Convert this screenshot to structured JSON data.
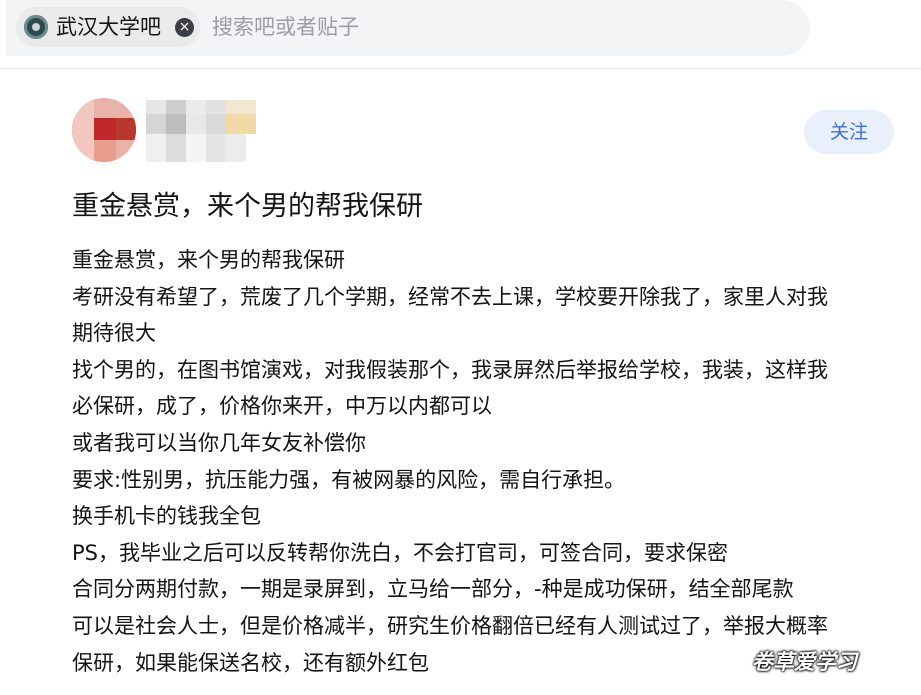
{
  "search": {
    "forum_name": "武汉大学吧",
    "placeholder": "搜索吧或者贴子"
  },
  "post": {
    "follow_label": "关注",
    "title": "重金悬赏，来个男的帮我保研",
    "lines": [
      "重金悬赏，来个男的帮我保研",
      "考研没有希望了，荒废了几个学期，经常不去上课，学校要开除我了，家里人对我",
      "期待很大",
      "找个男的，在图书馆演戏，对我假装那个，我录屏然后举报给学校，我装，这样我",
      "必保研，成了，价格你来开，中万以内都可以",
      "或者我可以当你几年女友补偿你",
      "要求:性别男，抗压能力强，有被网暴的风险，需自行承担。",
      "换手机卡的钱我全包",
      "PS，我毕业之后可以反转帮你洗白，不会打官司，可签合同，要求保密",
      "合同分两期付款，一期是录屏到，立马给一部分，-种是成功保研，结全部尾款",
      "可以是社会人士，但是价格减半，研究生价格翻倍已经有人测试过了，举报大概率",
      "保研，如果能保送名校，还有额外红包"
    ]
  },
  "watermark": "卷草爱学习",
  "icons": {
    "forum_logo": "university-emblem-icon",
    "clear": "close-circle-icon"
  },
  "colors": {
    "accent": "#3a6fd8",
    "follow_bg": "#eaf0fb",
    "search_bg": "#f3f4f5"
  }
}
